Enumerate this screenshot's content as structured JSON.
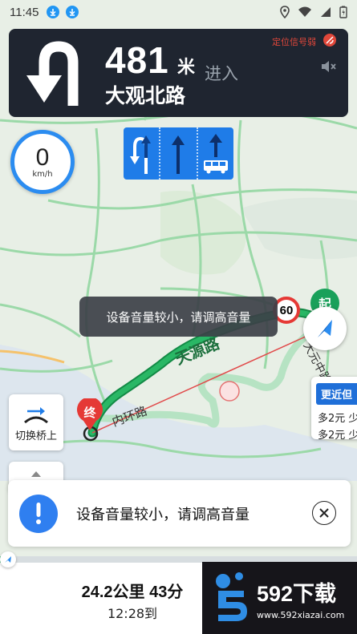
{
  "status_bar": {
    "time": "11:45",
    "icons": [
      "download-icon",
      "download-icon",
      "location-icon",
      "wifi-icon",
      "signal-icon",
      "battery-icon"
    ]
  },
  "guidance": {
    "distance": "481",
    "unit": "米",
    "action": "进入",
    "road": "大观北路",
    "gps_status": "定位信号弱",
    "turn_icon": "u-turn-left-icon"
  },
  "speed": {
    "value": "0",
    "unit": "km/h"
  },
  "lanes": [
    "u-turn-left-lane-icon",
    "straight-lane-icon",
    "bus-lane-icon"
  ],
  "toast": "设备音量较小，请调高音量",
  "map_labels": {
    "road_tianyuan": "天源路",
    "road_inner_ring": "内环路",
    "road_dadao": "大元中路",
    "speed_limit": "60",
    "start": "起",
    "end": "终"
  },
  "alt_route": {
    "header": "更近但",
    "line1": "多2元 少",
    "line2": "多2元 少"
  },
  "bridge_switch": {
    "label": "切换桥上"
  },
  "notice": {
    "text": "设备音量较小，请调高音量"
  },
  "trip": {
    "summary": "24.2公里 43分",
    "eta": "12:28到"
  },
  "progress": {
    "fraction": 0.03
  },
  "watermark": {
    "brand": "592下载",
    "url": "www.592xiazai.com"
  },
  "colors": {
    "route": "#1fa85e",
    "accent": "#2b8cf0",
    "card": "#1f2530",
    "lane": "#1f7ce8"
  }
}
